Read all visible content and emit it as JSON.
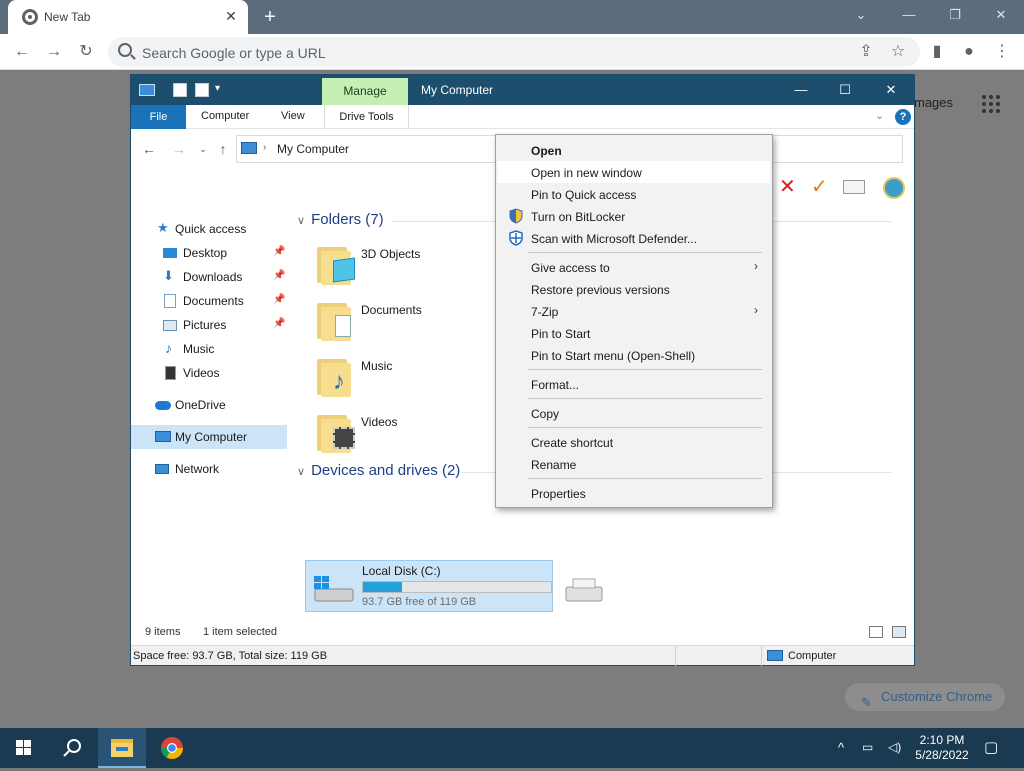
{
  "browser": {
    "tab_title": "New Tab",
    "omnibox_placeholder": "Search Google or type a URL",
    "images_link": "mages",
    "customize_label": "Customize Chrome"
  },
  "explorer": {
    "title": "My Computer",
    "manage_tab": "Manage",
    "ribbon": {
      "file": "File",
      "computer": "Computer",
      "view": "View",
      "drive_tools": "Drive Tools",
      "help": "?"
    },
    "address_path": "My Computer",
    "sidebar": [
      {
        "label": "Quick access",
        "icon": "star-icon",
        "pinned": false
      },
      {
        "label": "Desktop",
        "icon": "desktop-icon",
        "pinned": true
      },
      {
        "label": "Downloads",
        "icon": "download-icon",
        "pinned": true
      },
      {
        "label": "Documents",
        "icon": "documents-icon",
        "pinned": true
      },
      {
        "label": "Pictures",
        "icon": "pictures-icon",
        "pinned": true
      },
      {
        "label": "Music",
        "icon": "music-icon",
        "pinned": false
      },
      {
        "label": "Videos",
        "icon": "videos-icon",
        "pinned": false
      },
      {
        "label": "OneDrive",
        "icon": "cloud-icon",
        "pinned": false
      },
      {
        "label": "My Computer",
        "icon": "computer-icon",
        "pinned": false,
        "selected": true
      },
      {
        "label": "Network",
        "icon": "network-icon",
        "pinned": false
      }
    ],
    "folders_header": "Folders (7)",
    "folders": [
      {
        "label": "3D Objects",
        "icon": "3d-objects-icon"
      },
      {
        "label": "Documents",
        "icon": "documents-icon"
      },
      {
        "label": "Music",
        "icon": "music-icon"
      },
      {
        "label": "Videos",
        "icon": "videos-icon"
      }
    ],
    "devices_header": "Devices and drives (2)",
    "drive": {
      "label": "Local Disk (C:)",
      "free_text": "93.7 GB free of 119 GB",
      "used_fraction": 0.21
    },
    "status": {
      "items": "9 items",
      "selected": "1 item selected"
    },
    "info": {
      "left": "Space free: 93.7 GB, Total size: 119 GB",
      "right": "Computer"
    }
  },
  "context_menu": {
    "items": [
      {
        "label": "Open",
        "bold": true
      },
      {
        "label": "Open in new window",
        "hover": true
      },
      {
        "label": "Pin to Quick access"
      },
      {
        "label": "Turn on BitLocker",
        "icon": "shield-icon"
      },
      {
        "label": "Scan with Microsoft Defender...",
        "icon": "defender-icon"
      },
      {
        "label": "Give access to",
        "submenu": true
      },
      {
        "label": "Restore previous versions"
      },
      {
        "label": "7-Zip",
        "submenu": true
      },
      {
        "label": "Pin to Start"
      },
      {
        "label": "Pin to Start menu (Open-Shell)"
      },
      {
        "label": "Format..."
      },
      {
        "label": "Copy"
      },
      {
        "label": "Create shortcut"
      },
      {
        "label": "Rename"
      },
      {
        "label": "Properties"
      }
    ]
  },
  "taskbar": {
    "time": "2:10 PM",
    "date": "5/28/2022"
  },
  "colors": {
    "explorer_title_bg": "#1e4e6e",
    "manage_tab_bg": "#c6efb3",
    "accent": "#1a73b8",
    "selection": "#cce4f7",
    "taskbar_bg": "#1a3a52"
  }
}
